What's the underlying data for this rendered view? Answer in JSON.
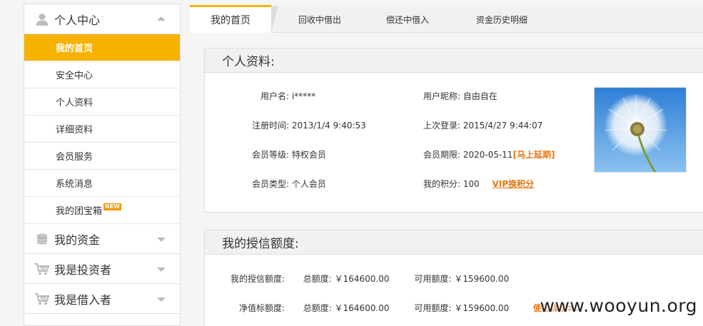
{
  "sidebar": {
    "personal": {
      "title": "个人中心",
      "icon": "user-icon",
      "items": [
        {
          "label": "我的首页"
        },
        {
          "label": "安全中心"
        },
        {
          "label": "个人资料"
        },
        {
          "label": "详细资料"
        },
        {
          "label": "会员服务"
        },
        {
          "label": "系统消息"
        },
        {
          "label": "我的团宝箱",
          "badge": "NEW"
        }
      ]
    },
    "funds": {
      "title": "我的资金",
      "icon": "coins-icon"
    },
    "investor": {
      "title": "我是投资者",
      "icon": "cart-icon"
    },
    "borrower": {
      "title": "我是借入者",
      "icon": "cart-icon"
    }
  },
  "tabs": [
    "我的首页",
    "回收中借出",
    "偿还中借入",
    "资金历史明细"
  ],
  "profile": {
    "heading": "个人资料:",
    "username_label": "用户名:",
    "username": "i*****",
    "nickname_label": "用户昵称:",
    "nickname": "自由自在",
    "register_label": "注册时间:",
    "register_time": "2013/1/4 9:40:53",
    "lastlogin_label": "上次登录:",
    "last_login": "2015/4/27 9:44:07",
    "level_label": "会员等级:",
    "level": "特权会员",
    "expire_label": "会员期限:",
    "expire": "2020-05-11",
    "extend_link": "[马上延期]",
    "type_label": "会员类型:",
    "type": "个人会员",
    "points_label": "我的积分:",
    "points": "100",
    "vip_link": "VIP换积分",
    "avatar_icon": "dandelion-photo"
  },
  "credit": {
    "heading": "我的授信额度:",
    "rows": [
      {
        "label": "我的授信额度:",
        "total_label": "总额度:",
        "total": "￥164600.00",
        "avail_label": "可用额度:",
        "avail": "￥159600.00"
      },
      {
        "label": "净值标额度:",
        "total_label": "总额度:",
        "total": "￥164600.00",
        "avail_label": "可用额度:",
        "avail": "￥159600.00",
        "detail_link": "使用详情>>"
      }
    ]
  },
  "watermark": "www.wooyun.org",
  "colors": {
    "accent": "#f5b300",
    "link": "#e8740c"
  }
}
